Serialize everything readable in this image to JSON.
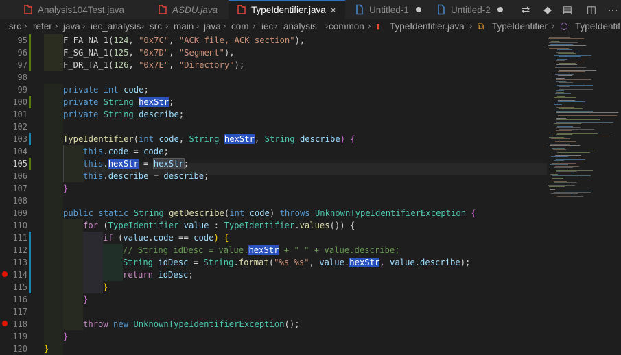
{
  "tabs": [
    {
      "label": "Analysis104Test.java",
      "italic": false,
      "active": false,
      "dirty": false,
      "icon": "java-file-icon"
    },
    {
      "label": "ASDU.java",
      "italic": true,
      "active": false,
      "dirty": false,
      "icon": "java-file-icon"
    },
    {
      "label": "TypeIdentifier.java",
      "italic": false,
      "active": true,
      "dirty": false,
      "icon": "java-file-icon",
      "close": "×"
    },
    {
      "label": "Untitled-1",
      "italic": false,
      "active": false,
      "dirty": true,
      "icon": "file-icon"
    },
    {
      "label": "Untitled-2",
      "italic": false,
      "active": false,
      "dirty": true,
      "icon": "file-icon"
    }
  ],
  "actions": [
    {
      "name": "compare-changes-icon",
      "glyph": "⇄"
    },
    {
      "name": "git-icon",
      "glyph": "◆"
    },
    {
      "name": "preview-icon",
      "glyph": "▤"
    },
    {
      "name": "split-editor-icon",
      "glyph": "◫"
    },
    {
      "name": "more-actions-icon",
      "glyph": "···"
    }
  ],
  "breadcrumbs": [
    "src",
    "refer",
    "java",
    "iec_analysis",
    "src",
    "main",
    "java",
    "com",
    "iec",
    "analysis",
    "common",
    "TypeIdentifier.java",
    "TypeIdentifier",
    "TypeIdentif"
  ],
  "editor": {
    "gutter": [
      "95",
      "96",
      "97",
      "98",
      "99",
      "100",
      "101",
      "102",
      "103",
      "104",
      "105",
      "106",
      "107",
      "108",
      "109",
      "110",
      "111",
      "112",
      "113",
      "114",
      "115",
      "116",
      "117",
      "118",
      "119",
      "120"
    ],
    "breakpoints": [
      "114",
      "118"
    ],
    "current_line": "105",
    "lines": {
      "l95": [
        "F_FA_NA_1",
        "(",
        "124",
        ", ",
        "\"0x7C\"",
        ", ",
        "\"ACK file, ACK section\"",
        "),"
      ],
      "l96": [
        "F_SG_NA_1",
        "(",
        "125",
        ", ",
        "\"0x7D\"",
        ", ",
        "\"Segment\"",
        "),"
      ],
      "l97": [
        "F_DR_TA_1",
        "(",
        "126",
        ", ",
        "\"0x7E\"",
        ", ",
        "\"Directory\"",
        ");"
      ],
      "l99": [
        "private",
        " ",
        "int",
        " ",
        "code",
        ";"
      ],
      "l100": [
        "private",
        " ",
        "String",
        " ",
        "hexStr",
        ";"
      ],
      "l101": [
        "private",
        " ",
        "String",
        " ",
        "describe",
        ";"
      ],
      "l103": [
        "TypeIdentifier",
        "(",
        "int",
        " ",
        "code",
        ", ",
        "String",
        " ",
        "hexStr",
        ", ",
        "String",
        " ",
        "describe",
        ") {"
      ],
      "l104": [
        "this",
        ".",
        "code",
        " = ",
        "code",
        ";"
      ],
      "l105": [
        "this",
        ".",
        "hexStr",
        " = ",
        "hexStr",
        ";"
      ],
      "l106": [
        "this",
        ".",
        "describe",
        " = ",
        "describe",
        ";"
      ],
      "l107": [
        "}"
      ],
      "l109": [
        "public",
        " ",
        "static",
        " ",
        "String",
        " ",
        "getDescribe",
        "(",
        "int",
        " ",
        "code",
        ") ",
        "throws",
        " ",
        "UnknownTypeIdentifierException",
        " {"
      ],
      "l110": [
        "for",
        " (",
        "TypeIdentifier",
        " ",
        "value",
        " : ",
        "TypeIdentifier",
        ".",
        "values",
        "()) {"
      ],
      "l111": [
        "if",
        " (",
        "value",
        ".",
        "code",
        " == ",
        "code",
        ") {"
      ],
      "l112": [
        "// String idDesc = value.",
        "hexStr",
        " + \" \" + value.describe;"
      ],
      "l113": [
        "String",
        " ",
        "idDesc",
        " = ",
        "String",
        ".",
        "format",
        "(",
        "\"%s %s\"",
        ", ",
        "value",
        ".",
        "hexStr",
        ", ",
        "value",
        ".",
        "describe",
        ");"
      ],
      "l114": [
        "return",
        " ",
        "idDesc",
        ";"
      ],
      "l115": [
        "}"
      ],
      "l116": [
        "}"
      ],
      "l118": [
        "throw",
        " ",
        "new",
        " ",
        "UnknownTypeIdentifierException",
        "();"
      ],
      "l119": [
        "}"
      ],
      "l120": [
        "}"
      ]
    }
  },
  "colors": {
    "background": "#1e1e1e",
    "selection_highlight": "#2a52be",
    "breakpoint": "#e51400",
    "added_line": "#587c0c",
    "modified_line": "#1b81a8",
    "tab_active_border": "#2e6fbf"
  }
}
